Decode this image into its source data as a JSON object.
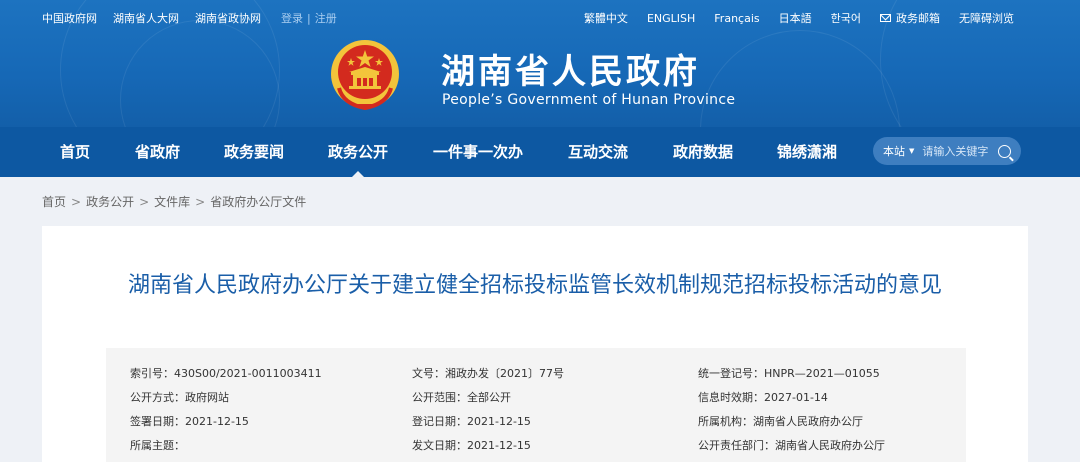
{
  "top_links": [
    "中国政府网",
    "湖南省人大网",
    "湖南省政协网"
  ],
  "auth": {
    "login": "登录",
    "sep": "|",
    "register": "注册"
  },
  "lang_links": [
    "繁體中文",
    "ENGLISH",
    "Français",
    "日本語",
    "한국어"
  ],
  "mail_label": "政务邮箱",
  "accessible_label": "无障碍浏览",
  "site": {
    "title": "湖南省人民政府",
    "subtitle": "People’s Government of Hunan Province"
  },
  "nav": [
    "首页",
    "省政府",
    "政务要闻",
    "政务公开",
    "一件事一次办",
    "互动交流",
    "政府数据",
    "锦绣潇湘"
  ],
  "nav_active": "政务公开",
  "search": {
    "scope": "本站",
    "caret": "▼",
    "placeholder": "请输入关键字"
  },
  "breadcrumb": [
    "首页",
    "政务公开",
    "文件库",
    "省政府办公厅文件"
  ],
  "breadcrumb_sep": ">",
  "document": {
    "title": "湖南省人民政府办公厅关于建立健全招标投标监管长效机制规范招标投标活动的意见",
    "meta": [
      {
        "label": "索引号：",
        "value": "430S00/2021-0011003411"
      },
      {
        "label": "文号：",
        "value": "湘政办发〔2021〕77号"
      },
      {
        "label": "统一登记号：",
        "value": "HNPR—2021—01055"
      },
      {
        "label": "公开方式：",
        "value": "政府网站"
      },
      {
        "label": "公开范围：",
        "value": "全部公开"
      },
      {
        "label": "信息时效期：",
        "value": "2027-01-14"
      },
      {
        "label": "签署日期：",
        "value": "2021-12-15"
      },
      {
        "label": "登记日期：",
        "value": "2021-12-15"
      },
      {
        "label": "所属机构：",
        "value": "湖南省人民政府办公厅"
      },
      {
        "label": "所属主题：",
        "value": ""
      },
      {
        "label": "发文日期：",
        "value": "2021-12-15"
      },
      {
        "label": "公开责任部门：",
        "value": "湖南省人民政府办公厅"
      }
    ]
  },
  "colors": {
    "header": "#1668b6",
    "nav": "#0d58a2",
    "title": "#1a5ea8",
    "emblem_red": "#d32a1e",
    "emblem_gold": "#f3c43b"
  }
}
